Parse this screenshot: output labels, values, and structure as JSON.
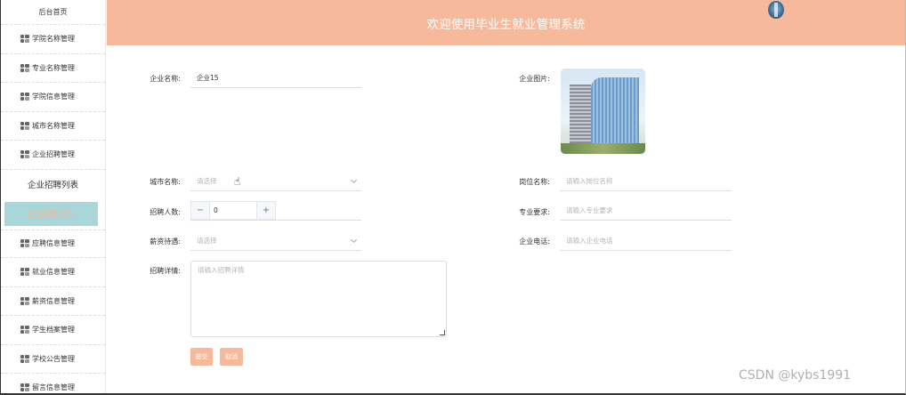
{
  "header": {
    "title": "欢迎使用毕业生就业管理系统"
  },
  "sidebar": {
    "home": "后台首页",
    "items_top": [
      {
        "label": "学院名称管理"
      },
      {
        "label": "专业名称管理"
      },
      {
        "label": "学院信息管理"
      },
      {
        "label": "城市名称管理"
      },
      {
        "label": "企业招聘管理"
      }
    ],
    "sub_items": [
      {
        "label": "企业招聘列表"
      },
      {
        "label": "企业招聘添加"
      }
    ],
    "items_bottom": [
      {
        "label": "应聘信息管理"
      },
      {
        "label": "就业信息管理"
      },
      {
        "label": "薪资信息管理"
      },
      {
        "label": "学生档案管理"
      },
      {
        "label": "学校公告管理"
      },
      {
        "label": "留言信息管理"
      }
    ]
  },
  "form": {
    "company_name": {
      "label": "企业名称:",
      "value": "企业15"
    },
    "company_image": {
      "label": "企业图片:"
    },
    "city": {
      "label": "城市名称:",
      "placeholder": "请选择"
    },
    "position": {
      "label": "岗位名称:",
      "placeholder": "请输入岗位名称"
    },
    "recruit_count": {
      "label": "招聘人数:",
      "value": "0",
      "minus": "−",
      "plus": "+"
    },
    "major_req": {
      "label": "专业要求:",
      "placeholder": "请输入专业要求"
    },
    "salary": {
      "label": "薪资待遇:",
      "placeholder": "请选择"
    },
    "phone": {
      "label": "企业电话:",
      "placeholder": "请输入企业电话"
    },
    "details": {
      "label": "招聘详情:",
      "placeholder": "请输入招聘详情"
    },
    "submit": "提交",
    "cancel": "取消"
  },
  "watermark": "CSDN @kybs1991",
  "colors": {
    "accent": "#f7b99b",
    "active_bg": "#a9d7d9"
  }
}
